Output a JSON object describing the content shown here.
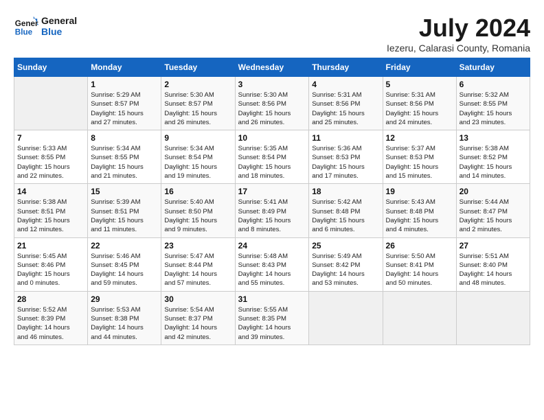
{
  "header": {
    "logo_line1": "General",
    "logo_line2": "Blue",
    "month": "July 2024",
    "location": "Iezeru, Calarasi County, Romania"
  },
  "days_of_week": [
    "Sunday",
    "Monday",
    "Tuesday",
    "Wednesday",
    "Thursday",
    "Friday",
    "Saturday"
  ],
  "weeks": [
    [
      {
        "day": "",
        "info": ""
      },
      {
        "day": "1",
        "info": "Sunrise: 5:29 AM\nSunset: 8:57 PM\nDaylight: 15 hours\nand 27 minutes."
      },
      {
        "day": "2",
        "info": "Sunrise: 5:30 AM\nSunset: 8:57 PM\nDaylight: 15 hours\nand 26 minutes."
      },
      {
        "day": "3",
        "info": "Sunrise: 5:30 AM\nSunset: 8:56 PM\nDaylight: 15 hours\nand 26 minutes."
      },
      {
        "day": "4",
        "info": "Sunrise: 5:31 AM\nSunset: 8:56 PM\nDaylight: 15 hours\nand 25 minutes."
      },
      {
        "day": "5",
        "info": "Sunrise: 5:31 AM\nSunset: 8:56 PM\nDaylight: 15 hours\nand 24 minutes."
      },
      {
        "day": "6",
        "info": "Sunrise: 5:32 AM\nSunset: 8:55 PM\nDaylight: 15 hours\nand 23 minutes."
      }
    ],
    [
      {
        "day": "7",
        "info": "Sunrise: 5:33 AM\nSunset: 8:55 PM\nDaylight: 15 hours\nand 22 minutes."
      },
      {
        "day": "8",
        "info": "Sunrise: 5:34 AM\nSunset: 8:55 PM\nDaylight: 15 hours\nand 21 minutes."
      },
      {
        "day": "9",
        "info": "Sunrise: 5:34 AM\nSunset: 8:54 PM\nDaylight: 15 hours\nand 19 minutes."
      },
      {
        "day": "10",
        "info": "Sunrise: 5:35 AM\nSunset: 8:54 PM\nDaylight: 15 hours\nand 18 minutes."
      },
      {
        "day": "11",
        "info": "Sunrise: 5:36 AM\nSunset: 8:53 PM\nDaylight: 15 hours\nand 17 minutes."
      },
      {
        "day": "12",
        "info": "Sunrise: 5:37 AM\nSunset: 8:53 PM\nDaylight: 15 hours\nand 15 minutes."
      },
      {
        "day": "13",
        "info": "Sunrise: 5:38 AM\nSunset: 8:52 PM\nDaylight: 15 hours\nand 14 minutes."
      }
    ],
    [
      {
        "day": "14",
        "info": "Sunrise: 5:38 AM\nSunset: 8:51 PM\nDaylight: 15 hours\nand 12 minutes."
      },
      {
        "day": "15",
        "info": "Sunrise: 5:39 AM\nSunset: 8:51 PM\nDaylight: 15 hours\nand 11 minutes."
      },
      {
        "day": "16",
        "info": "Sunrise: 5:40 AM\nSunset: 8:50 PM\nDaylight: 15 hours\nand 9 minutes."
      },
      {
        "day": "17",
        "info": "Sunrise: 5:41 AM\nSunset: 8:49 PM\nDaylight: 15 hours\nand 8 minutes."
      },
      {
        "day": "18",
        "info": "Sunrise: 5:42 AM\nSunset: 8:48 PM\nDaylight: 15 hours\nand 6 minutes."
      },
      {
        "day": "19",
        "info": "Sunrise: 5:43 AM\nSunset: 8:48 PM\nDaylight: 15 hours\nand 4 minutes."
      },
      {
        "day": "20",
        "info": "Sunrise: 5:44 AM\nSunset: 8:47 PM\nDaylight: 15 hours\nand 2 minutes."
      }
    ],
    [
      {
        "day": "21",
        "info": "Sunrise: 5:45 AM\nSunset: 8:46 PM\nDaylight: 15 hours\nand 0 minutes."
      },
      {
        "day": "22",
        "info": "Sunrise: 5:46 AM\nSunset: 8:45 PM\nDaylight: 14 hours\nand 59 minutes."
      },
      {
        "day": "23",
        "info": "Sunrise: 5:47 AM\nSunset: 8:44 PM\nDaylight: 14 hours\nand 57 minutes."
      },
      {
        "day": "24",
        "info": "Sunrise: 5:48 AM\nSunset: 8:43 PM\nDaylight: 14 hours\nand 55 minutes."
      },
      {
        "day": "25",
        "info": "Sunrise: 5:49 AM\nSunset: 8:42 PM\nDaylight: 14 hours\nand 53 minutes."
      },
      {
        "day": "26",
        "info": "Sunrise: 5:50 AM\nSunset: 8:41 PM\nDaylight: 14 hours\nand 50 minutes."
      },
      {
        "day": "27",
        "info": "Sunrise: 5:51 AM\nSunset: 8:40 PM\nDaylight: 14 hours\nand 48 minutes."
      }
    ],
    [
      {
        "day": "28",
        "info": "Sunrise: 5:52 AM\nSunset: 8:39 PM\nDaylight: 14 hours\nand 46 minutes."
      },
      {
        "day": "29",
        "info": "Sunrise: 5:53 AM\nSunset: 8:38 PM\nDaylight: 14 hours\nand 44 minutes."
      },
      {
        "day": "30",
        "info": "Sunrise: 5:54 AM\nSunset: 8:37 PM\nDaylight: 14 hours\nand 42 minutes."
      },
      {
        "day": "31",
        "info": "Sunrise: 5:55 AM\nSunset: 8:35 PM\nDaylight: 14 hours\nand 39 minutes."
      },
      {
        "day": "",
        "info": ""
      },
      {
        "day": "",
        "info": ""
      },
      {
        "day": "",
        "info": ""
      }
    ]
  ]
}
